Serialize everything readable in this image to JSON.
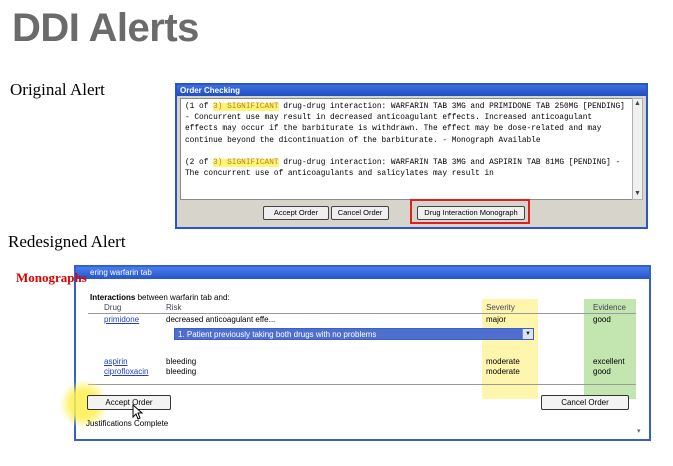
{
  "slide": {
    "title": "DDI Alerts",
    "original_label": "Original Alert",
    "redesigned_label": "Redesigned Alert",
    "monographs_label": "Monographs"
  },
  "original_alert": {
    "window_title": "Order Checking",
    "interaction1": {
      "prefix": "(1 of ",
      "count": "3) SIGNIFICANT",
      "text": " drug-drug interaction: WARFARIN TAB 3MG and PRIMIDONE TAB 250MG [PENDING] - Concurrent use may result in decreased anticoagulant effects. Increased anticoagulant effects may occur if the barbiturate is withdrawn. The effect may be dose-related and may continue beyond the dicontinuation of the barbiturate. - Monograph Available"
    },
    "interaction2": {
      "prefix": "(2 of ",
      "count": "3) SIGNIFICANT",
      "text": " drug-drug interaction: WARFARIN TAB 3MG and ASPIRIN TAB 81MG [PENDING] - The concurrent use of anticoagulants and salicylates may result in"
    },
    "buttons": {
      "accept": "Accept Order",
      "cancel": "Cancel Order",
      "monograph": "Drug Interaction Monograph"
    }
  },
  "redesigned_alert": {
    "window_title": "ering warfarin tab",
    "interactions_bold": "Interactions",
    "interactions_rest": " between warfarin tab and:",
    "headers": {
      "drug": "Drug",
      "risk": "Risk",
      "severity": "Severity",
      "evidence": "Evidence"
    },
    "rows": [
      {
        "drug": "primidone",
        "risk": "decreased anticoagulant effe...",
        "severity": "major",
        "evidence": "good"
      },
      {
        "drug": "aspirin",
        "risk": "bleeding",
        "severity": "moderate",
        "evidence": "excellent"
      },
      {
        "drug": "ciprofloxacin",
        "risk": "bleeding",
        "severity": "moderate",
        "evidence": "good"
      }
    ],
    "dropdown_value": "1. Patient previously taking both drugs with no problems",
    "buttons": {
      "accept": "Accept Order",
      "cancel": "Cancel Order"
    },
    "justifications": "Justifications Complete"
  }
}
